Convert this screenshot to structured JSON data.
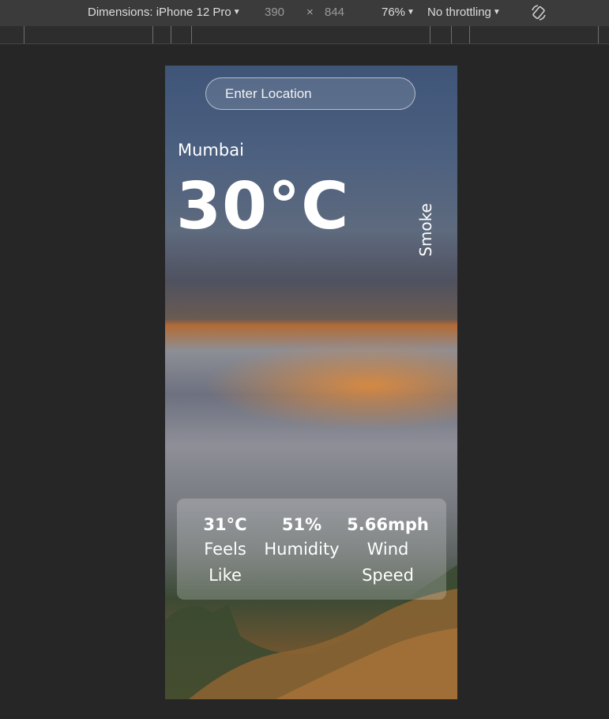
{
  "devtools": {
    "dimensions_label": "Dimensions: iPhone 12 Pro",
    "width": "390",
    "times": "×",
    "height": "844",
    "zoom": "76%",
    "throttling": "No throttling"
  },
  "search": {
    "placeholder": "Enter Location"
  },
  "weather": {
    "city": "Mumbai",
    "temperature": "30°C",
    "description": "Smoke"
  },
  "stats": [
    {
      "value": "31°C",
      "label_line1": "Feels",
      "label_line2": "Like"
    },
    {
      "value": "51%",
      "label_line1": "Humidity",
      "label_line2": ""
    },
    {
      "value": "5.66mph",
      "label_line1": "Wind",
      "label_line2": "Speed"
    }
  ]
}
